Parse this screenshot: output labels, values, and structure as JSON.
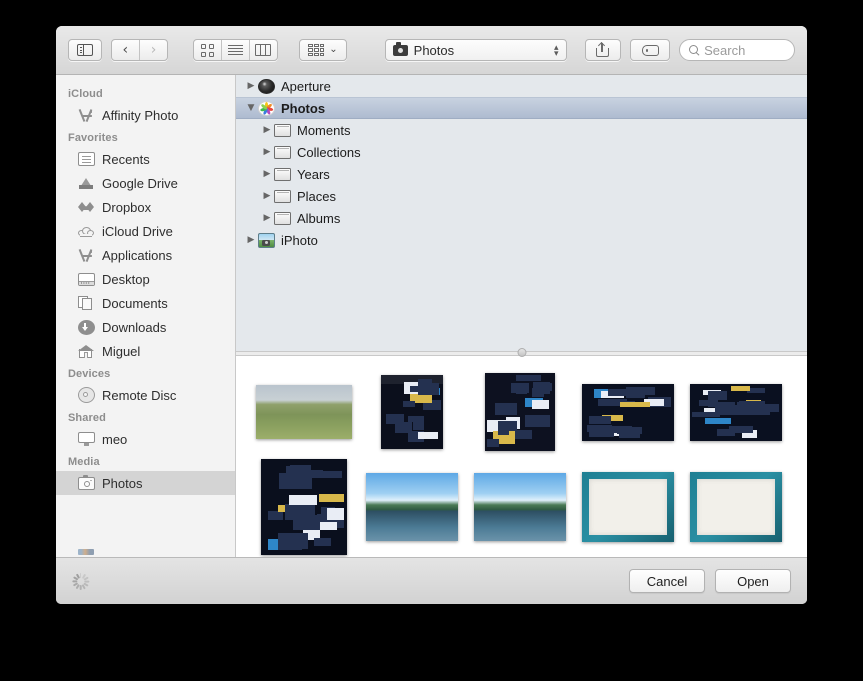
{
  "toolbar": {
    "sidebar_toggle": "sidebar-toggle",
    "back_glyph": "‹",
    "forward_glyph": "›",
    "view_icon_label": "icon-view",
    "view_list_label": "list-view",
    "view_column_label": "column-view",
    "arrange_label": "arrange",
    "arrange_chevron": "⌄",
    "path_label": "Photos",
    "stepper_up": "▴",
    "stepper_down": "▾",
    "share_label": "share",
    "tag_label": "tag",
    "search_placeholder": "Search"
  },
  "sidebar": {
    "sections": [
      {
        "header": "iCloud",
        "items": [
          {
            "label": "Affinity Photo",
            "icon": "app-icon",
            "selected": false
          }
        ]
      },
      {
        "header": "Favorites",
        "items": [
          {
            "label": "Recents",
            "icon": "recents-icon",
            "selected": false
          },
          {
            "label": "Google Drive",
            "icon": "google-drive-icon",
            "selected": false
          },
          {
            "label": "Dropbox",
            "icon": "dropbox-icon",
            "selected": false
          },
          {
            "label": "iCloud Drive",
            "icon": "cloud-icon",
            "selected": false
          },
          {
            "label": "Applications",
            "icon": "applications-icon",
            "selected": false
          },
          {
            "label": "Desktop",
            "icon": "desktop-icon",
            "selected": false
          },
          {
            "label": "Documents",
            "icon": "documents-icon",
            "selected": false
          },
          {
            "label": "Downloads",
            "icon": "downloads-icon",
            "selected": false
          },
          {
            "label": "Miguel",
            "icon": "home-icon",
            "selected": false
          }
        ]
      },
      {
        "header": "Devices",
        "items": [
          {
            "label": "Remote Disc",
            "icon": "disc-icon",
            "selected": false
          }
        ]
      },
      {
        "header": "Shared",
        "items": [
          {
            "label": "meo",
            "icon": "display-icon",
            "selected": false
          }
        ]
      },
      {
        "header": "Media",
        "items": [
          {
            "label": "Photos",
            "icon": "photos-icon",
            "selected": true
          }
        ]
      }
    ]
  },
  "tree": {
    "rows": [
      {
        "label": "Aperture",
        "icon": "aperture-icon",
        "indent": 0,
        "twisty": "collapsed",
        "selected": false
      },
      {
        "label": "Photos",
        "icon": "photos-app-icon",
        "indent": 0,
        "twisty": "expanded",
        "selected": true
      },
      {
        "label": "Moments",
        "icon": "folder-icon",
        "indent": 1,
        "twisty": "collapsed",
        "selected": false
      },
      {
        "label": "Collections",
        "icon": "folder-icon",
        "indent": 1,
        "twisty": "collapsed",
        "selected": false
      },
      {
        "label": "Years",
        "icon": "folder-icon",
        "indent": 1,
        "twisty": "collapsed",
        "selected": false
      },
      {
        "label": "Places",
        "icon": "folder-icon",
        "indent": 1,
        "twisty": "collapsed",
        "selected": false
      },
      {
        "label": "Albums",
        "icon": "folder-icon",
        "indent": 1,
        "twisty": "collapsed",
        "selected": false
      },
      {
        "label": "iPhoto",
        "icon": "iphoto-icon",
        "indent": 0,
        "twisty": "collapsed",
        "selected": false
      }
    ],
    "twisty_collapsed_glyph": "▶",
    "twisty_expanded_glyph": "▼"
  },
  "grid": {
    "rows": [
      [
        {
          "kind": "landscape-field"
        },
        {
          "kind": "dark-ui-portrait"
        },
        {
          "kind": "dark-ui-portrait-wide"
        },
        {
          "kind": "dark-ui-landscape"
        },
        {
          "kind": "dark-ui-landscape"
        }
      ],
      [
        {
          "kind": "dark-ui-tall"
        },
        {
          "kind": "lake-landscape"
        },
        {
          "kind": "lake-landscape"
        },
        {
          "kind": "document-on-teal"
        },
        {
          "kind": "document-on-teal"
        }
      ]
    ]
  },
  "bottom_bar": {
    "progress_label": "loading",
    "cancel_label": "Cancel",
    "open_label": "Open"
  },
  "colors": {
    "selection_blue": "#aebbd0",
    "sidebar_bg": "#f3f3f3",
    "tree_bg": "#e4e8ec",
    "toolbar_top": "#e9e9e9",
    "toolbar_bottom": "#d6d6d6"
  }
}
